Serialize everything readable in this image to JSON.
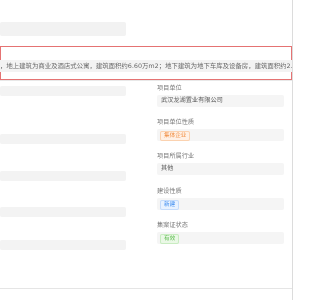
{
  "description": {
    "text": "，地上建筑为商业及酒店式公寓，建筑面积约6.60万m2；地下建筑为地下车库及设备房，建筑面积约2.09万m2。建"
  },
  "fields": [
    {
      "label": "项目单位",
      "value": "武汉龙湖置业有限公司",
      "tag": null
    },
    {
      "label": "项目单位性质",
      "value": "",
      "tag": "集体企业",
      "tag_color": "orange"
    },
    {
      "label": "项目所属行业",
      "value": "其他",
      "tag": null
    },
    {
      "label": "建设性质",
      "value": "",
      "tag": "新建",
      "tag_color": "blue"
    },
    {
      "label": "集案证状态",
      "value": "",
      "tag": "有效",
      "tag_color": "green"
    }
  ]
}
